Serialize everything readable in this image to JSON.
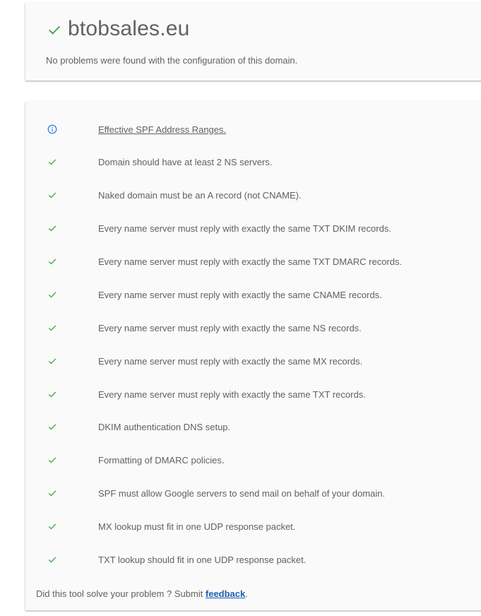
{
  "summary": {
    "domain": "btobsales.eu",
    "message": "No problems were found with the configuration of this domain.",
    "status_icon": "check-icon",
    "status_color": "#43a047"
  },
  "checks": [
    {
      "icon": "info-icon",
      "label": "Effective SPF Address Ranges.",
      "is_link": true
    },
    {
      "icon": "check-icon",
      "label": "Domain should have at least 2 NS servers."
    },
    {
      "icon": "check-icon",
      "label": "Naked domain must be an A record (not CNAME)."
    },
    {
      "icon": "check-icon",
      "label": "Every name server must reply with exactly the same TXT DKIM records."
    },
    {
      "icon": "check-icon",
      "label": "Every name server must reply with exactly the same TXT DMARC records."
    },
    {
      "icon": "check-icon",
      "label": "Every name server must reply with exactly the same CNAME records."
    },
    {
      "icon": "check-icon",
      "label": "Every name server must reply with exactly the same NS records."
    },
    {
      "icon": "check-icon",
      "label": "Every name server must reply with exactly the same MX records."
    },
    {
      "icon": "check-icon",
      "label": "Every name server must reply with exactly the same TXT records."
    },
    {
      "icon": "check-icon",
      "label": "DKIM authentication DNS setup."
    },
    {
      "icon": "check-icon",
      "label": "Formatting of DMARC policies."
    },
    {
      "icon": "check-icon",
      "label": "SPF must allow Google servers to send mail on behalf of your domain."
    },
    {
      "icon": "check-icon",
      "label": "MX lookup must fit in one UDP response packet."
    },
    {
      "icon": "check-icon",
      "label": "TXT lookup should fit in one UDP response packet."
    }
  ],
  "footer": {
    "prefix": "Did this tool solve your problem ? Submit ",
    "link_label": "feedback",
    "suffix": "."
  },
  "colors": {
    "check": "#43a047",
    "info": "#1a73e8",
    "link": "#1a5fb4"
  }
}
